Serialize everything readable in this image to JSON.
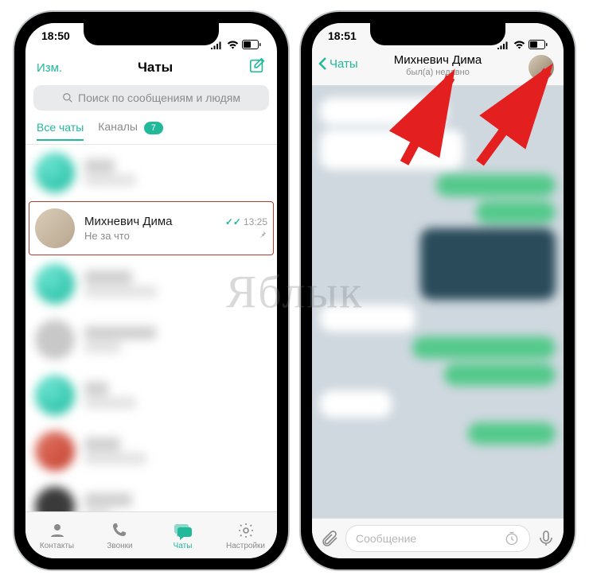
{
  "colors": {
    "accent": "#21b99a",
    "red": "#e41f1f"
  },
  "watermark": "Яблык",
  "left": {
    "status_time": "18:50",
    "header": {
      "edit": "Изм.",
      "title": "Чаты"
    },
    "search_placeholder": "Поиск по сообщениям и людям",
    "scope_tabs": {
      "all": "Все чаты",
      "channels": "Каналы",
      "channels_badge": "7"
    },
    "highlighted_chat": {
      "name": "Михневич Дима",
      "preview": "Не за что",
      "time": "13:25",
      "read_checks": "✓✓",
      "pinned": true
    },
    "tabbar": {
      "contacts": "Контакты",
      "calls": "Звонки",
      "chats": "Чаты",
      "settings": "Настройки",
      "active": "chats"
    }
  },
  "right": {
    "status_time": "18:51",
    "back_label": "Чаты",
    "contact_name": "Михневич Дима",
    "last_seen": "был(а) недавно",
    "input_placeholder": "Сообщение"
  }
}
